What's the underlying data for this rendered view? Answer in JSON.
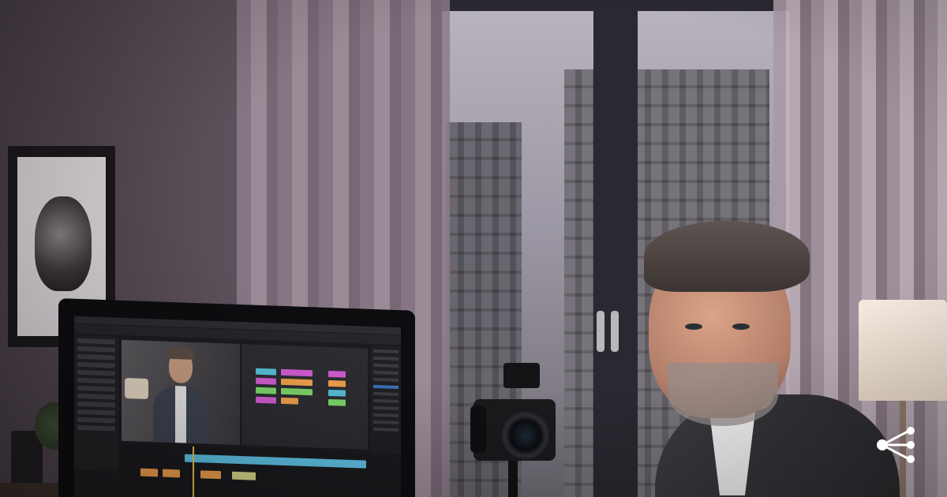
{
  "image": {
    "alt_description_visible": "",
    "share_icon": "share-icon"
  },
  "colors": {
    "wall": "#5b4f5a",
    "sky": "#b9b4bf",
    "timeline_cyan": "#5fc3e6",
    "clip_magenta": "#d05bd0",
    "clip_orange": "#f0a04c",
    "clip_green": "#7bd66a",
    "clip_cyan": "#55c0d8"
  }
}
